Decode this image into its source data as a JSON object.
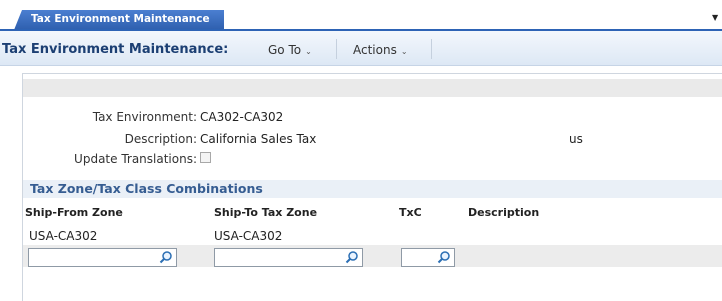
{
  "tab": {
    "label": "Tax Environment Maintenance"
  },
  "header": {
    "title": "Tax Environment Maintenance:",
    "menu": [
      {
        "label": "Go To"
      },
      {
        "label": "Actions"
      }
    ]
  },
  "form": {
    "tax_environment": {
      "label": "Tax Environment:",
      "value": "CA302-CA302"
    },
    "description": {
      "label": "Description:",
      "value": "California Sales Tax",
      "extra": "us"
    },
    "update_translations": {
      "label": "Update Translations:",
      "checked": false
    }
  },
  "section": {
    "title": "Tax Zone/Tax Class Combinations",
    "columns": [
      "Ship-From Zone",
      "Ship-To Tax Zone",
      "TxC",
      "Description"
    ],
    "rows": [
      [
        "USA-CA302",
        "USA-CA302",
        "",
        ""
      ]
    ]
  },
  "icons": {
    "lookup": "magnifier-icon",
    "menu_caret": "chevron-down-icon"
  },
  "colors": {
    "accent": "#2d63b5",
    "title": "#1c3f73",
    "section_title": "#365d92"
  }
}
